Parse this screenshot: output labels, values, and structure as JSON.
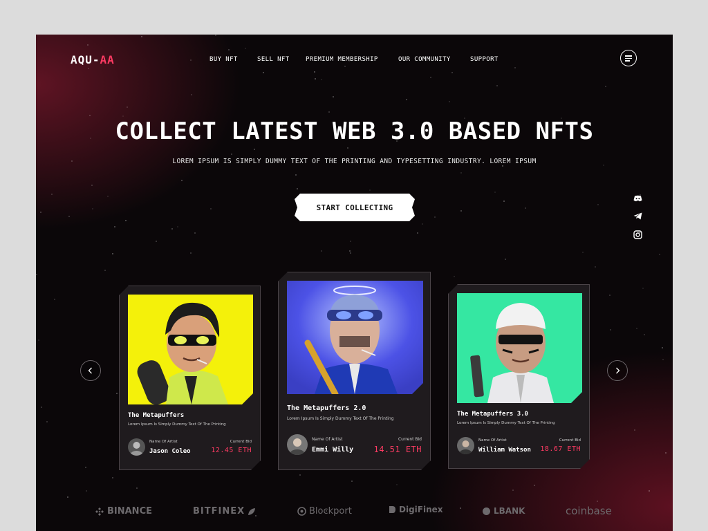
{
  "logo": {
    "part1": "AQU-",
    "part2": "AA"
  },
  "nav": {
    "items": [
      {
        "label": "BUY NFT"
      },
      {
        "label": "SELL NFT"
      },
      {
        "label": "PREMIUM MEMBERSHIP"
      },
      {
        "label": "OUR COMMUNITY"
      },
      {
        "label": "SUPPORT"
      }
    ],
    "menu_icon": "hamburger-icon"
  },
  "hero": {
    "title": "COLLECT LATEST WEB 3.0 BASED NFTS",
    "subtitle": "LOREM IPSUM IS SIMPLY DUMMY TEXT OF THE PRINTING AND TYPESETTING INDUSTRY. LOREM IPSUM",
    "cta": "START COLLECTING"
  },
  "social": [
    "discord-icon",
    "telegram-icon",
    "instagram-icon"
  ],
  "cards": [
    {
      "title": "The Metapuffers",
      "description": "Lorem Ipsum Is Simply Dummy Text Of The Printing",
      "artist_label": "Name Of Artist",
      "artist_name": "Jason Coleo",
      "bid_label": "Current Bid",
      "bid": "12.45 ETH",
      "bg": "#f4f10a"
    },
    {
      "title": "The Metapuffers 2.0",
      "description": "Lorem Ipsum Is Simply Dummy Text Of The Printing",
      "artist_label": "Name Of Artist",
      "artist_name": "Emmi Willy",
      "bid_label": "Current Bid",
      "bid": "14.51 ETH",
      "bg": "#4c52e6"
    },
    {
      "title": "The Metapuffers 3.0",
      "description": "Lorem Ipsum Is Simply Dummy Text Of The Printing",
      "artist_label": "Name Of Artist",
      "artist_name": "William Watson",
      "bid_label": "Current Bid",
      "bid": "18.67 ETH",
      "bg": "#35e7a2"
    }
  ],
  "partners": [
    "BINANCE",
    "BITFINEX",
    "Blockport",
    "DigiFinex",
    "LBANK",
    "coinbase"
  ],
  "colors": {
    "accent": "#ff3b63",
    "background": "#0b0709",
    "card": "#1f1b1e"
  }
}
